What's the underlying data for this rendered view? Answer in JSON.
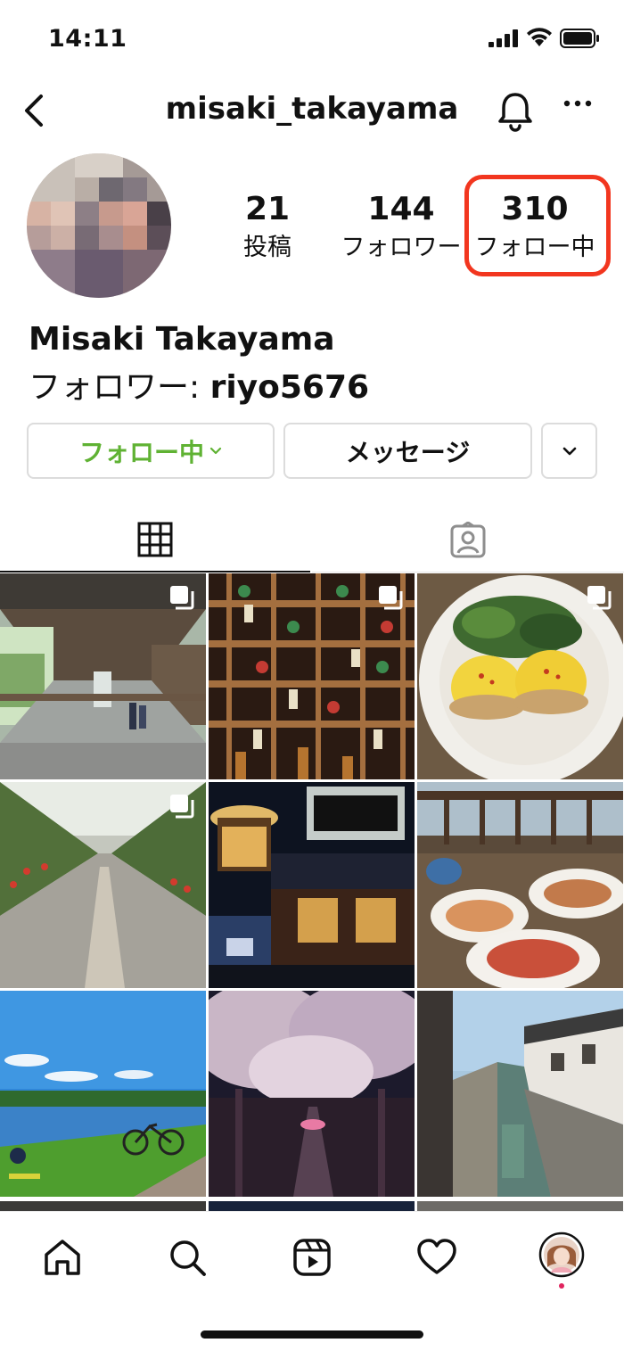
{
  "status_bar": {
    "time": "14:11"
  },
  "header": {
    "username": "misaki_takayama"
  },
  "profile": {
    "stats": {
      "posts": {
        "value": "21",
        "label": "投稿"
      },
      "followers": {
        "value": "144",
        "label": "フォロワー"
      },
      "following": {
        "value": "310",
        "label": "フォロー中"
      }
    },
    "full_name": "Misaki Takayama",
    "followed_by_prefix": "フォロワー: ",
    "followed_by_user": "riyo5676"
  },
  "actions": {
    "following_label": "フォロー中",
    "message_label": "メッセージ"
  },
  "tabs": [
    "grid-icon",
    "tagged-icon"
  ],
  "posts": [
    {
      "subject": "covered wooden bridge",
      "multiple": true
    },
    {
      "subject": "wind chimes and ema",
      "multiple": true
    },
    {
      "subject": "eggs benedict",
      "multiple": true
    },
    {
      "subject": "strawberry greenhouse",
      "multiple": true
    },
    {
      "subject": "beach film festival",
      "multiple": false
    },
    {
      "subject": "pasta lunch by the sea",
      "multiple": false
    },
    {
      "subject": "lake with bicycle",
      "multiple": false
    },
    {
      "subject": "cherry blossom tunnel",
      "multiple": false
    },
    {
      "subject": "canal with old houses",
      "multiple": false
    }
  ],
  "bottom_nav": [
    "home-icon",
    "search-icon",
    "reels-icon",
    "heart-icon",
    "profile-avatar"
  ],
  "colors": {
    "accent_green": "#5fb233",
    "highlight_red": "#f2361f"
  }
}
